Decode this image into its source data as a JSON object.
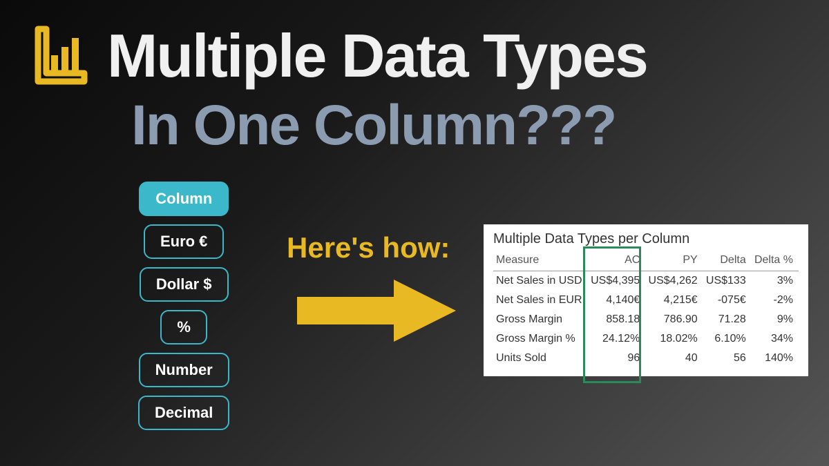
{
  "title_main": "Multiple Data Types",
  "title_sub": "In One Column???",
  "chips": {
    "column": "Column",
    "euro": "Euro €",
    "dollar": "Dollar $",
    "percent": "%",
    "number": "Number",
    "decimal": "Decimal"
  },
  "heres_how": "Here's how:",
  "table": {
    "title": "Multiple Data Types per Column",
    "headers": {
      "measure": "Measure",
      "ac": "AC",
      "py": "PY",
      "delta": "Delta",
      "delta_pct": "Delta %"
    },
    "rows": [
      {
        "measure": "Net Sales in USD",
        "ac": "US$4,395",
        "py": "US$4,262",
        "delta": "US$133",
        "delta_pct": "3%"
      },
      {
        "measure": "Net Sales in EUR",
        "ac": "4,140€",
        "py": "4,215€",
        "delta": "-075€",
        "delta_pct": "-2%"
      },
      {
        "measure": "Gross Margin",
        "ac": "858.18",
        "py": "786.90",
        "delta": "71.28",
        "delta_pct": "9%"
      },
      {
        "measure": "Gross Margin %",
        "ac": "24.12%",
        "py": "18.02%",
        "delta": "6.10%",
        "delta_pct": "34%"
      },
      {
        "measure": "Units Sold",
        "ac": "96",
        "py": "40",
        "delta": "56",
        "delta_pct": "140%"
      }
    ]
  },
  "colors": {
    "accent_yellow": "#e8b923",
    "accent_teal": "#3bb8c9",
    "highlight_green": "#2a8a5c"
  }
}
